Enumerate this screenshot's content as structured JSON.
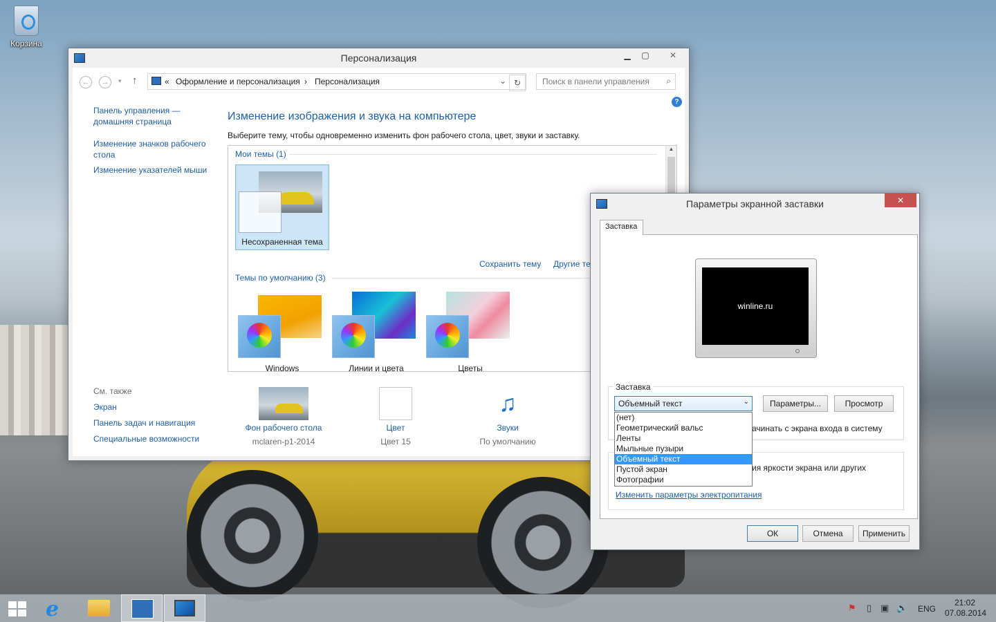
{
  "desktop": {
    "recycle_bin_label": "Корзина"
  },
  "personalization": {
    "title": "Персонализация",
    "breadcrumb": {
      "prefix": "«",
      "item1": "Оформление и персонализация",
      "sep": "›",
      "item2": "Персонализация"
    },
    "search_placeholder": "Поиск в панели управления",
    "left_nav": {
      "home": "Панель управления — домашняя страница",
      "desktop_icons": "Изменение значков рабочего стола",
      "mouse_pointers": "Изменение указателей мыши"
    },
    "see_also": {
      "heading": "См. также",
      "items": [
        "Экран",
        "Панель задач и навигация",
        "Специальные возможности"
      ]
    },
    "heading": "Изменение изображения и звука на компьютере",
    "subheading": "Выберите тему, чтобы одновременно изменить фон рабочего стола, цвет, звуки и заставку.",
    "my_themes": {
      "label": "Мои темы (1)",
      "themes": [
        {
          "name": "Несохраненная тема"
        }
      ]
    },
    "save_theme": "Сохранить тему",
    "other_themes": "Другие те",
    "default_themes": {
      "label": "Темы по умолчанию (3)",
      "themes": [
        {
          "name": "Windows"
        },
        {
          "name": "Линии и цвета"
        },
        {
          "name": "Цветы"
        }
      ]
    },
    "bottom": {
      "background": {
        "label": "Фон рабочего стола",
        "value": "mclaren-p1-2014"
      },
      "color": {
        "label": "Цвет",
        "value": "Цвет 15"
      },
      "sounds": {
        "label": "Звуки",
        "value": "По умолчанию"
      }
    }
  },
  "screensaver": {
    "title": "Параметры экранной заставки",
    "tab": "Заставка",
    "preview_text": "winline.ru",
    "group_label": "Заставка",
    "selected": "Объемный текст",
    "options": [
      "(нет)",
      "Геометрический вальс",
      "Ленты",
      "Мыльные пузыри",
      "Объемный текст",
      "Пустой экран",
      "Фотографии"
    ],
    "params_button": "Параметры...",
    "preview_button": "Просмотр",
    "logon_text_partial": "ачинать с экрана входа в систему",
    "power_text_partial": "ия яркости экрана или других",
    "power_link": "Изменить параметры электропитания",
    "ok": "ОК",
    "cancel": "Отмена",
    "apply": "Применить"
  },
  "taskbar": {
    "language": "ENG",
    "time": "21:02",
    "date": "07.08.2014"
  }
}
